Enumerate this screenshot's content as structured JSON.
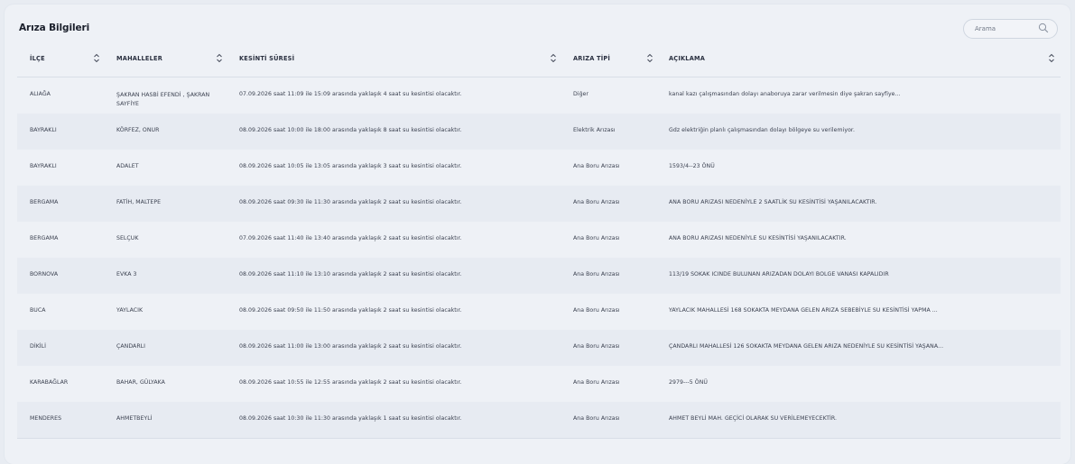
{
  "title": "Arıza Bilgileri",
  "search": {
    "placeholder": "Arama"
  },
  "columns": [
    "İLÇE",
    "MAHALLELER",
    "KESİNTİ SÜRESİ",
    "ARIZA TİPİ",
    "AÇIKLAMA"
  ],
  "rows": [
    {
      "ilce": "ALIAĞA",
      "mahalle": "ŞAKRAN HASBİ EFENDİ , ŞAKRAN SAYFİYE",
      "sure": "07.09.2026 saat 11:09 ile 15:09 arasında yaklaşık 4 saat su kesintisi olacaktır.",
      "tip": "Diğer",
      "aciklama": "kanal kazı çalışmasından dolayı anaboruya zarar verilmesin diye şakran sayfiye..."
    },
    {
      "ilce": "BAYRAKLI",
      "mahalle": "KÖRFEZ, ONUR",
      "sure": "08.09.2026 saat 10:00 ile 18:00 arasında yaklaşık 8 saat su kesintisi olacaktır.",
      "tip": "Elektrik Arızası",
      "aciklama": "Gdz elektriğin planlı çalışmasından dolayı bölgeye su verilemiyor."
    },
    {
      "ilce": "BAYRAKLI",
      "mahalle": "ADALET",
      "sure": "08.09.2026 saat 10:05 ile 13:05 arasında yaklaşık 3 saat su kesintisi olacaktır.",
      "tip": "Ana Boru Arızası",
      "aciklama": "1593/4--23 ÖNÜ"
    },
    {
      "ilce": "BERGAMA",
      "mahalle": "FATİH, MALTEPE",
      "sure": "08.09.2026 saat 09:30 ile 11:30 arasında yaklaşık 2 saat su kesintisi olacaktır.",
      "tip": "Ana Boru Arızası",
      "aciklama": "ANA BORU ARIZASI NEDENİYLE 2 SAATLİK SU KESİNTİSİ YAŞANILACAKTIR."
    },
    {
      "ilce": "BERGAMA",
      "mahalle": "SELÇUK",
      "sure": "07.09.2026 saat 11:40 ile 13:40 arasında yaklaşık 2 saat su kesintisi olacaktır.",
      "tip": "Ana Boru Arızası",
      "aciklama": "ANA BORU ARIZASI NEDENİYLE SU KESİNTİSİ YAŞANILACAKTIR."
    },
    {
      "ilce": "BORNOVA",
      "mahalle": "EVKA 3",
      "sure": "08.09.2026 saat 11:10 ile 13:10 arasında yaklaşık 2 saat su kesintisi olacaktır.",
      "tip": "Ana Boru Arızası",
      "aciklama": "113/19 SOKAK ICINDE BULUNAN ARIZADAN DOLAYI BOLGE VANASI KAPALIDIR"
    },
    {
      "ilce": "BUCA",
      "mahalle": "YAYLACIK",
      "sure": "08.09.2026 saat 09:50 ile 11:50 arasında yaklaşık 2 saat su kesintisi olacaktır.",
      "tip": "Ana Boru Arızası",
      "aciklama": "YAYLACIK MAHALLESİ 168 SOKAKTA MEYDANA GELEN ARIZA SEBEBİYLE SU KESİNTİSİ YAPMA ..."
    },
    {
      "ilce": "DİKİLİ",
      "mahalle": "ÇANDARLI",
      "sure": "08.09.2026 saat 11:00 ile 13:00 arasında yaklaşık 2 saat su kesintisi olacaktır.",
      "tip": "Ana Boru Arızası",
      "aciklama": "ÇANDARLI MAHALLESİ 126 SOKAKTA MEYDANA GELEN ARIZA NEDENİYLE SU KESİNTİSİ YAŞANA..."
    },
    {
      "ilce": "KARABAĞLAR",
      "mahalle": "BAHAR, GÜLYAKA",
      "sure": "08.09.2026 saat 10:55 ile 12:55 arasında yaklaşık 2 saat su kesintisi olacaktır.",
      "tip": "Ana Boru Arızası",
      "aciklama": "2979---5 ÖNÜ"
    },
    {
      "ilce": "MENDERES",
      "mahalle": "AHMETBEYLİ",
      "sure": "08.09.2026 saat 10:30 ile 11:30 arasında yaklaşık 1 saat su kesintisi olacaktır.",
      "tip": "Ana Boru Arızası",
      "aciklama": "AHMET BEYLİ MAH. GEÇİCİ OLARAK SU VERİLEMEYECEKTİR."
    }
  ]
}
